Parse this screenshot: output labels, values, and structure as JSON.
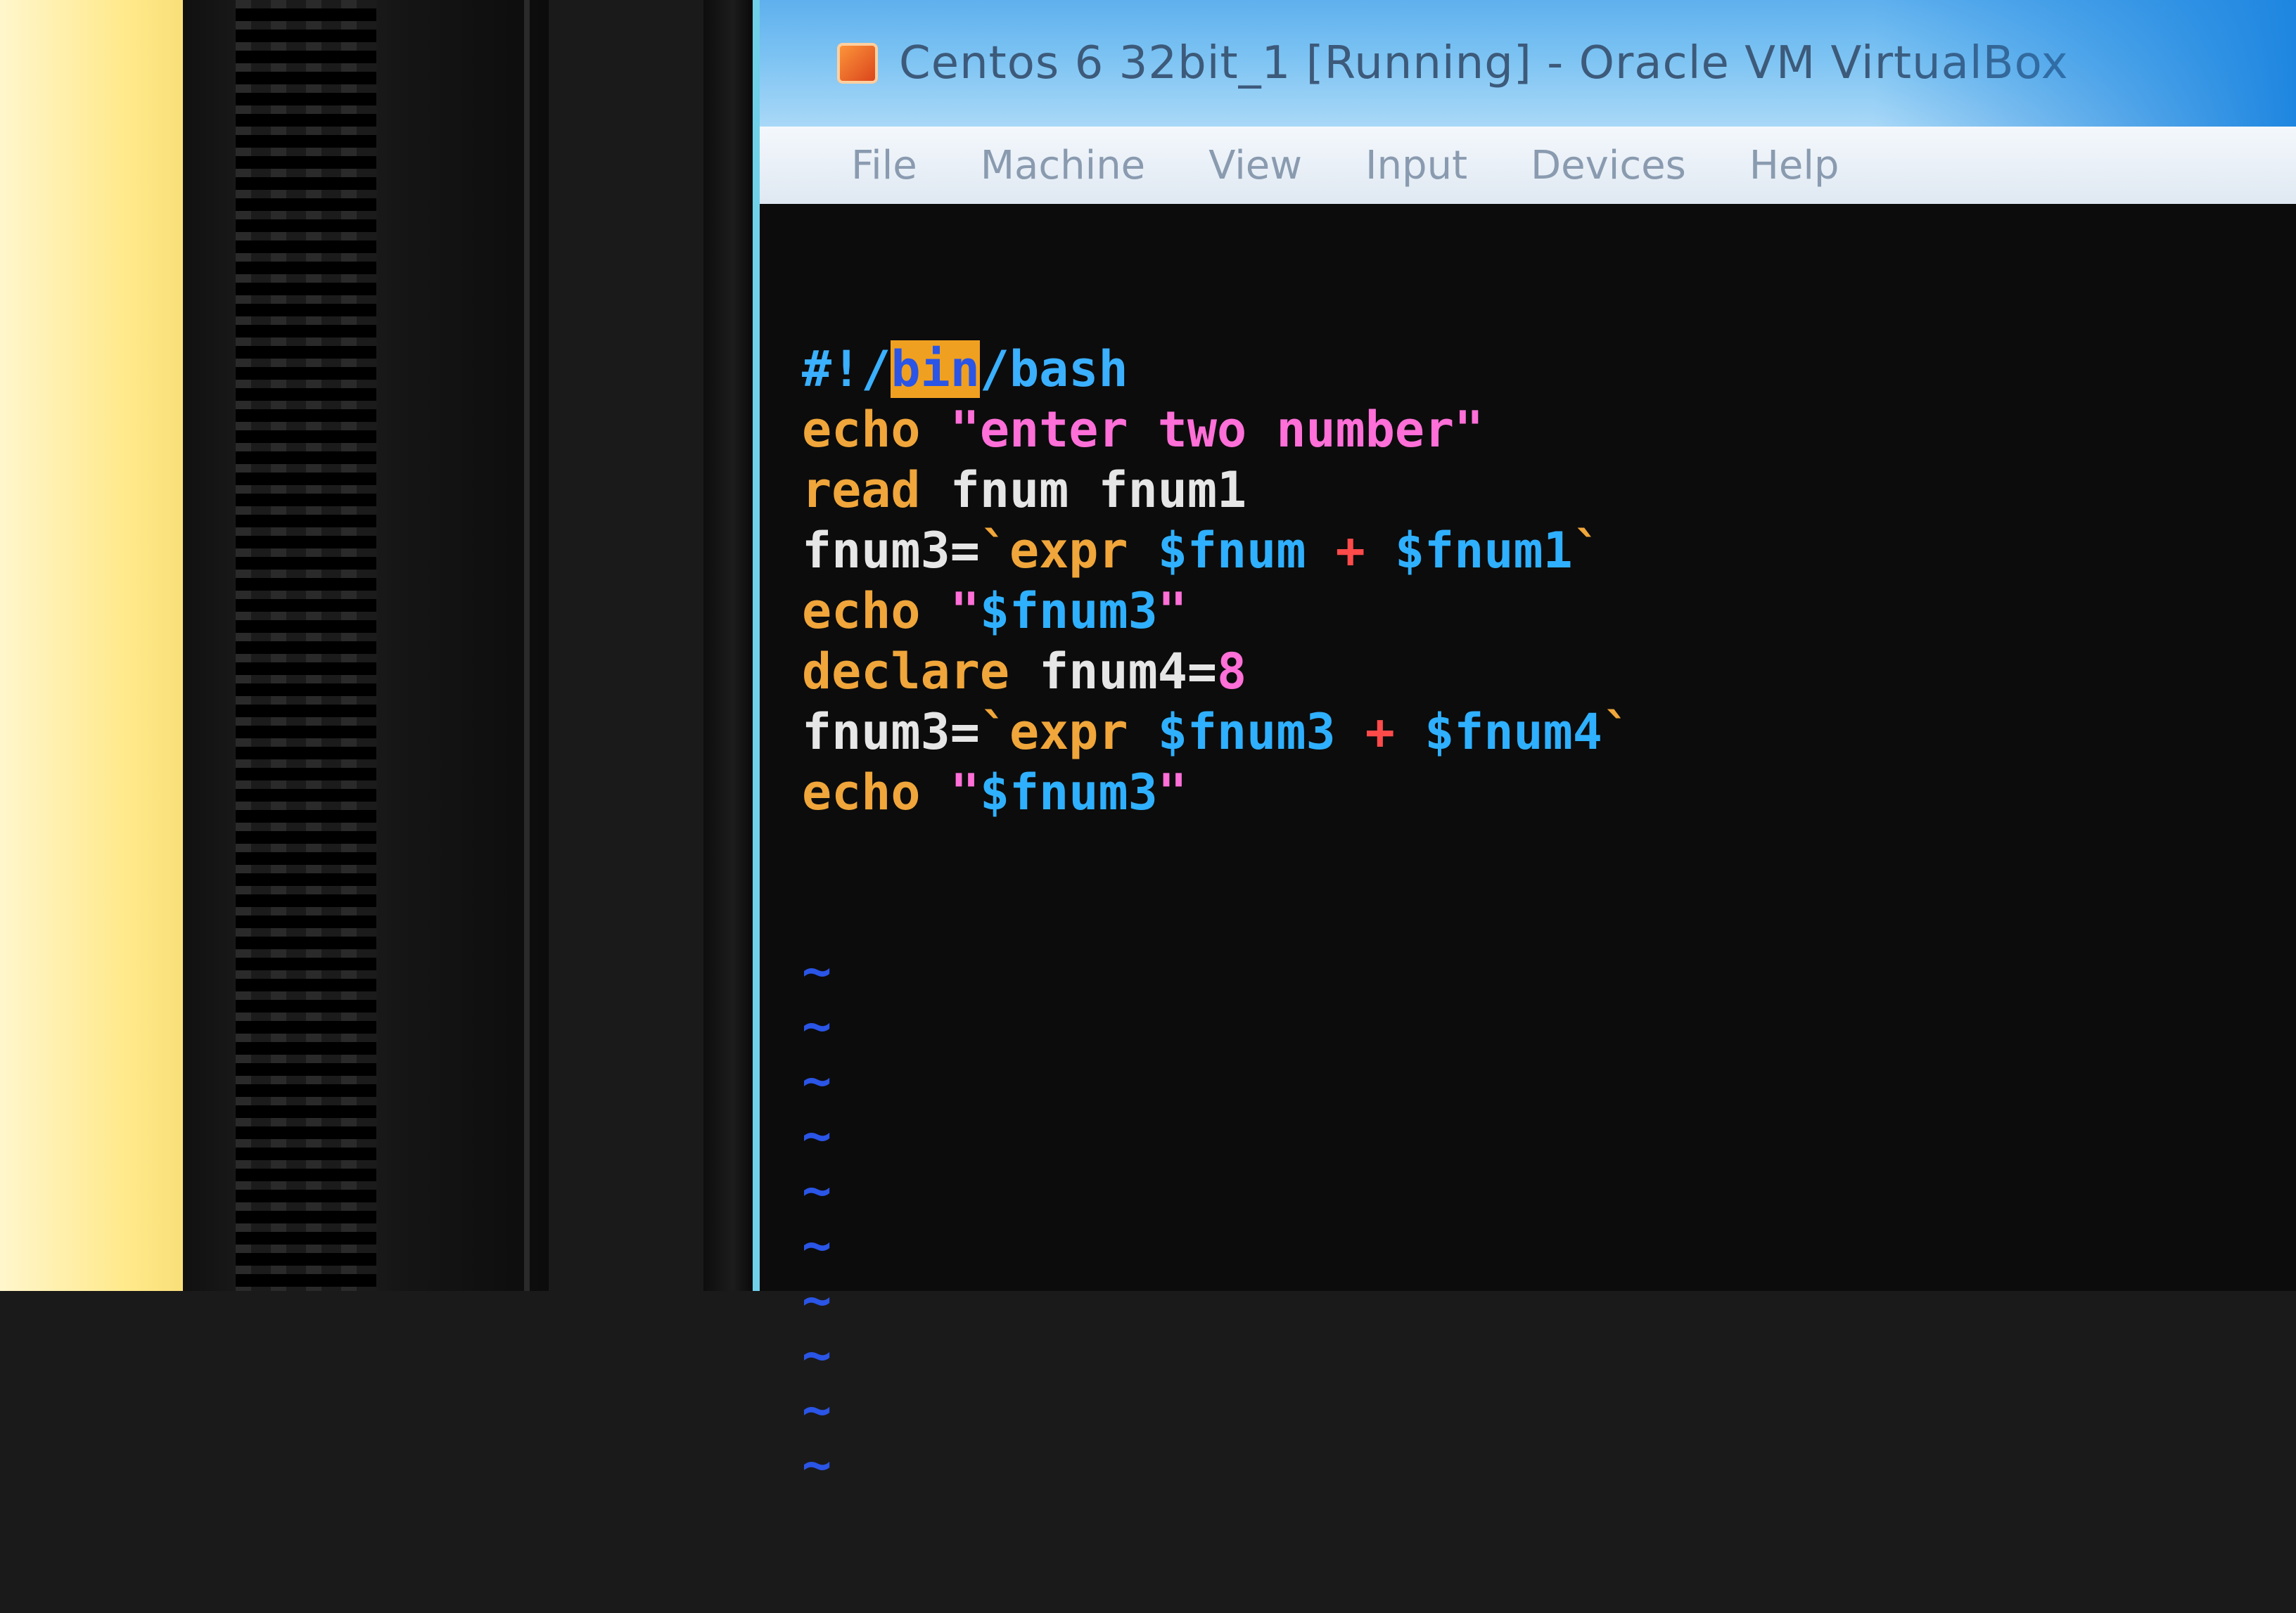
{
  "window": {
    "title": "Centos 6 32bit_1 [Running] - Oracle VM VirtualBox"
  },
  "menubar": {
    "items": [
      "File",
      "Machine",
      "View",
      "Input",
      "Devices",
      "Help"
    ]
  },
  "editor": {
    "lines": [
      {
        "parts": [
          [
            "c-comment",
            "#!/"
          ],
          [
            "c-hl",
            "bin"
          ],
          [
            "c-comment",
            "/bash"
          ]
        ]
      },
      {
        "parts": [
          [
            "c-kw",
            "echo"
          ],
          [
            "c-plain",
            " "
          ],
          [
            "c-str",
            "\"enter two number\""
          ]
        ]
      },
      {
        "parts": [
          [
            "c-kw",
            "read"
          ],
          [
            "c-plain",
            " fnum fnum1"
          ]
        ]
      },
      {
        "parts": [
          [
            "c-plain",
            "fnum3="
          ],
          [
            "c-kw",
            "`expr "
          ],
          [
            "c-var",
            "$fnum"
          ],
          [
            "c-op",
            " + "
          ],
          [
            "c-var",
            "$fnum1"
          ],
          [
            "c-kw",
            "`"
          ]
        ]
      },
      {
        "parts": [
          [
            "c-kw",
            "echo"
          ],
          [
            "c-plain",
            " "
          ],
          [
            "c-str",
            "\""
          ],
          [
            "c-var",
            "$fnum3"
          ],
          [
            "c-str",
            "\""
          ]
        ]
      },
      {
        "parts": [
          [
            "c-kw",
            "declare"
          ],
          [
            "c-plain",
            " fnum4="
          ],
          [
            "c-num",
            "8"
          ]
        ]
      },
      {
        "parts": [
          [
            "c-plain",
            "fnum3="
          ],
          [
            "c-kw",
            "`expr "
          ],
          [
            "c-var",
            "$fnum3"
          ],
          [
            "c-op",
            " + "
          ],
          [
            "c-var",
            "$fnum4"
          ],
          [
            "c-kw",
            "`"
          ]
        ]
      },
      {
        "parts": [
          [
            "c-kw",
            "echo"
          ],
          [
            "c-plain",
            " "
          ],
          [
            "c-str",
            "\""
          ],
          [
            "c-var",
            "$fnum3"
          ],
          [
            "c-str",
            "\""
          ]
        ]
      }
    ],
    "empty_line_marker": "~",
    "empty_line_count": 10
  }
}
